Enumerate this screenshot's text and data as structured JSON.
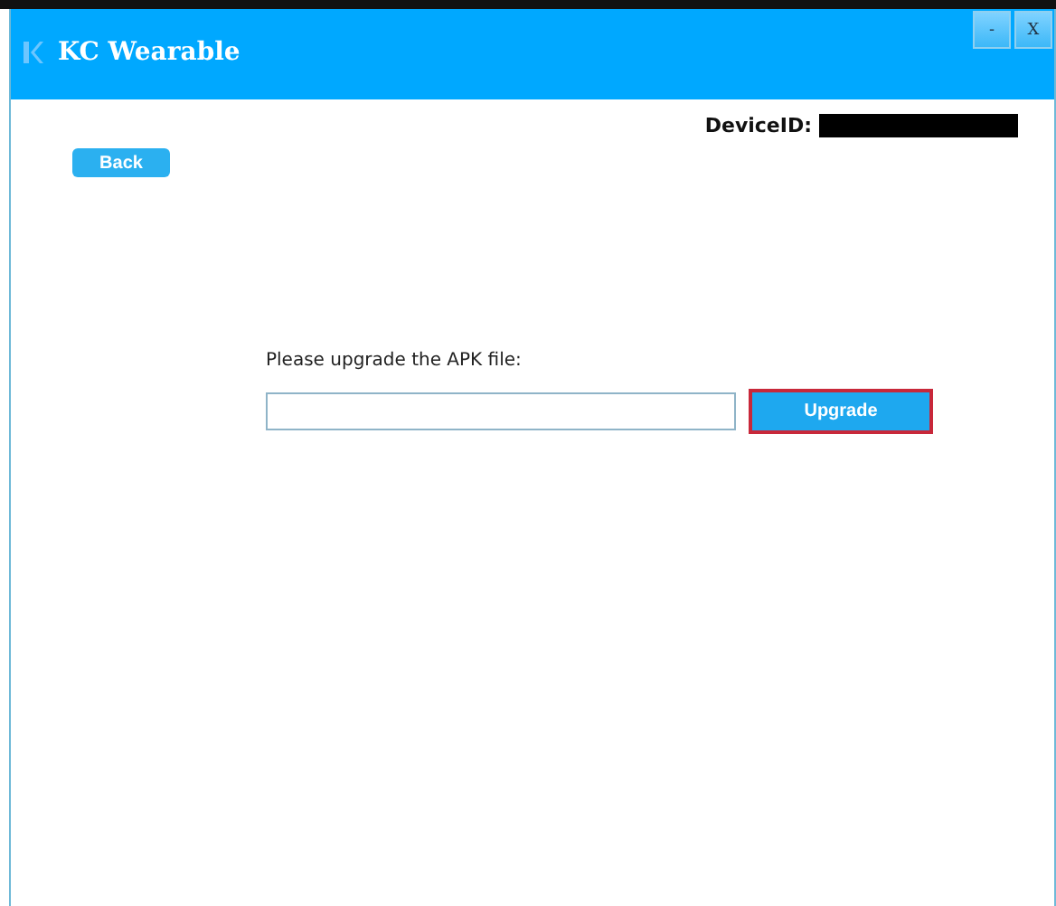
{
  "window": {
    "title": "KC Wearable",
    "controls": [
      "-",
      "X"
    ]
  },
  "device": {
    "label": "DeviceID:",
    "value_redacted": true
  },
  "back_button": {
    "label": "Back"
  },
  "upgrade": {
    "prompt": "Please upgrade the APK file:",
    "button": {
      "label": "Upgrade",
      "focused": true
    }
  }
}
